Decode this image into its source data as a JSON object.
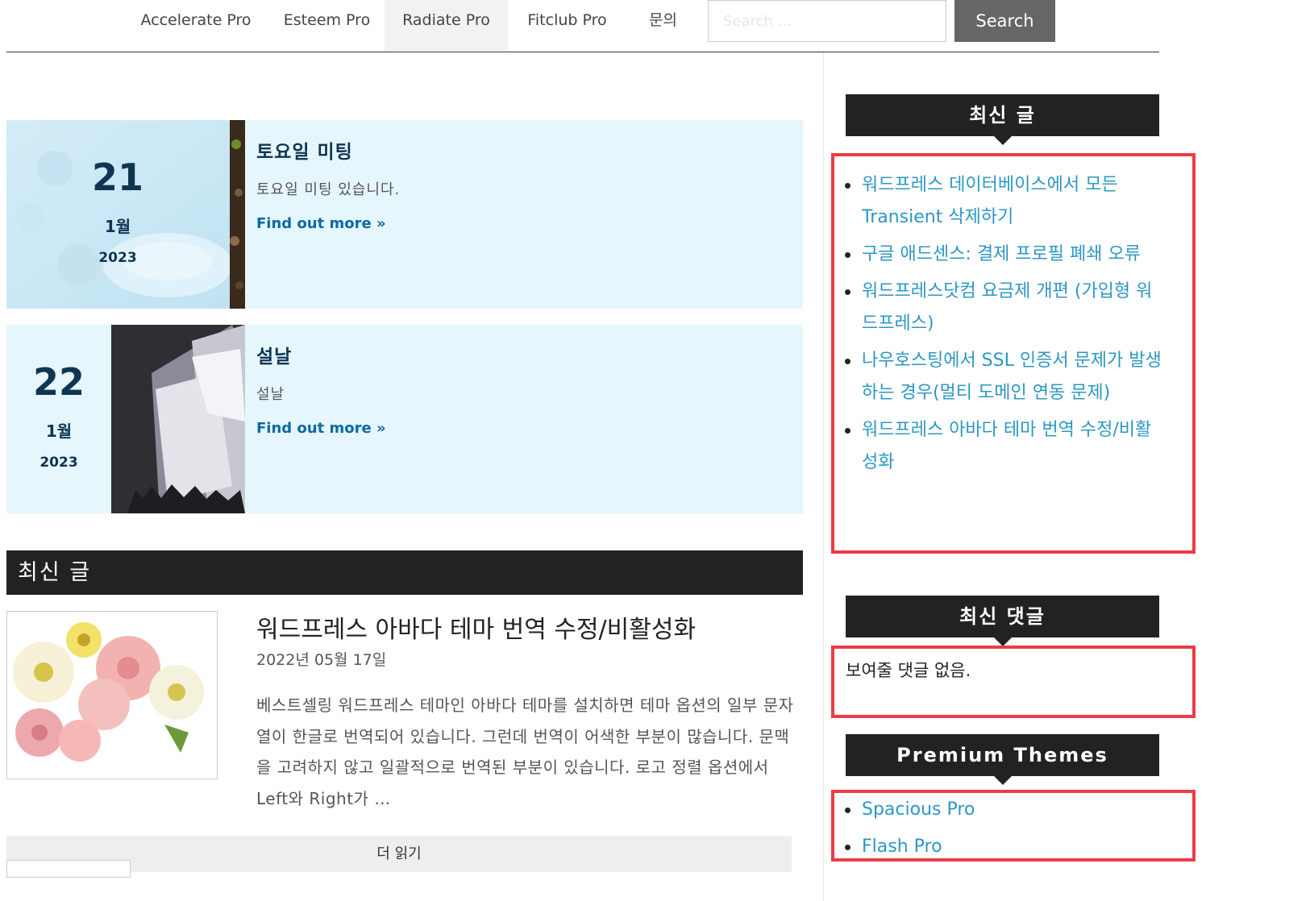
{
  "nav": {
    "items": [
      "Accelerate Pro",
      "Esteem Pro",
      "Radiate Pro",
      "Fitclub Pro",
      "문의"
    ],
    "active_index": 2,
    "search_placeholder": "Search …",
    "search_button": "Search"
  },
  "events": [
    {
      "day": "21",
      "month": "1월",
      "year": "2023",
      "title": "토요일 미팅",
      "description": "토요일 미팅 있습니다.",
      "link": "Find out more »"
    },
    {
      "day": "22",
      "month": "1월",
      "year": "2023",
      "title": "설날",
      "description": "설날",
      "link": "Find out more »"
    }
  ],
  "latest": {
    "heading": "최신 글",
    "post": {
      "title": "워드프레스 아바다 테마 번역 수정/비활성화",
      "date": "2022년 05월 17일",
      "excerpt": "베스트셀링 워드프레스 테마인 아바다 테마를 설치하면 테마 옵션의 일부 문자열이 한글로 번역되어 있습니다. 그런데 번역이 어색한 부분이 많습니다. 문맥을 고려하지 않고 일괄적으로 번역된 부분이 있습니다. 로고 정렬 옵션에서 Left와 Right가 …"
    },
    "read_more": "더 읽기"
  },
  "sidebar": {
    "recent_posts": {
      "title": "최신 글",
      "items": [
        "워드프레스 데이터베이스에서 모든 Transient 삭제하기",
        "구글 애드센스: 결제 프로필 폐쇄 오류",
        "워드프레스닷컴 요금제 개편 (가입형 워드프레스)",
        "나우호스팅에서 SSL 인증서 문제가 발생하는 경우(멀티 도메인 연동 문제)",
        "워드프레스 아바다 테마 번역 수정/비활성화"
      ]
    },
    "recent_comments": {
      "title": "최신 댓글",
      "empty_text": "보여줄 댓글 없음."
    },
    "premium_themes": {
      "title": "Premium Themes",
      "items": [
        "Spacious Pro",
        "Flash Pro"
      ]
    }
  },
  "colors": {
    "highlight": "#ee3b44",
    "link": "#2c97c4",
    "event_bg": "#e6f6fd",
    "dark": "#222222"
  }
}
